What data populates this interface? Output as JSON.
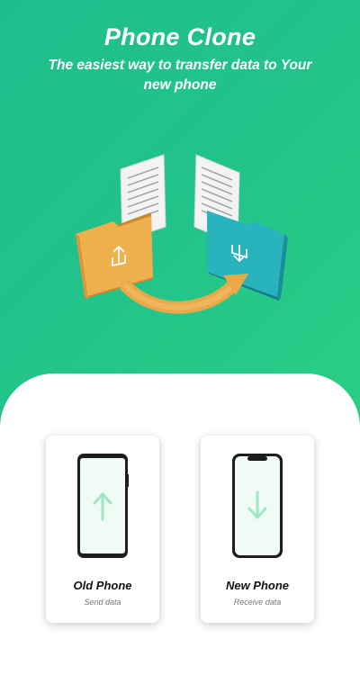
{
  "header": {
    "title": "Phone Clone",
    "subtitle": "The easiest way to transfer data to Your new phone"
  },
  "options": [
    {
      "title": "Old Phone",
      "subtitle": "Send data",
      "icon": "arrow-up-icon"
    },
    {
      "title": "New Phone",
      "subtitle": "Receive data",
      "icon": "arrow-down-icon"
    }
  ],
  "colors": {
    "brand_green": "#22c48a",
    "folder_orange": "#e9a948",
    "folder_teal": "#1fa9b4",
    "arrow_mint": "#9fe6c8"
  }
}
